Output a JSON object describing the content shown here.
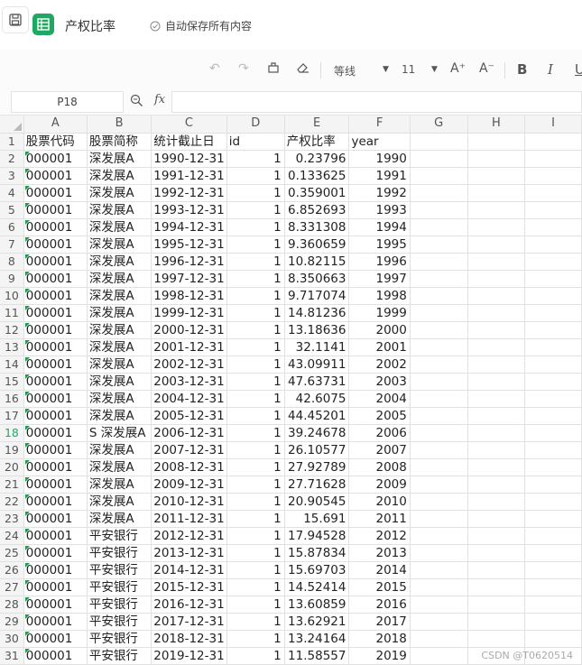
{
  "app": {
    "doc_title": "产权比率",
    "autosave": "自动保存所有内容"
  },
  "toolbar": {
    "font_name": "等线",
    "font_size": "11",
    "bold": "B",
    "italic": "I",
    "underline": "U",
    "grow": "A⁺",
    "shrink": "A⁻"
  },
  "formula_bar": {
    "name_box": "P18",
    "fx": "fx",
    "value": ""
  },
  "columns": [
    "A",
    "B",
    "C",
    "D",
    "E",
    "F",
    "G",
    "H",
    "I"
  ],
  "selected_row": 18,
  "rows": [
    [
      "股票代码",
      "股票简称",
      "统计截止日",
      "id",
      "产权比率",
      "year"
    ],
    [
      "000001",
      "深发展A",
      "1990-12-31",
      "1",
      "0.23796",
      "1990"
    ],
    [
      "000001",
      "深发展A",
      "1991-12-31",
      "1",
      "0.133625",
      "1991"
    ],
    [
      "000001",
      "深发展A",
      "1992-12-31",
      "1",
      "0.359001",
      "1992"
    ],
    [
      "000001",
      "深发展A",
      "1993-12-31",
      "1",
      "6.852693",
      "1993"
    ],
    [
      "000001",
      "深发展A",
      "1994-12-31",
      "1",
      "8.331308",
      "1994"
    ],
    [
      "000001",
      "深发展A",
      "1995-12-31",
      "1",
      "9.360659",
      "1995"
    ],
    [
      "000001",
      "深发展A",
      "1996-12-31",
      "1",
      "10.82115",
      "1996"
    ],
    [
      "000001",
      "深发展A",
      "1997-12-31",
      "1",
      "8.350663",
      "1997"
    ],
    [
      "000001",
      "深发展A",
      "1998-12-31",
      "1",
      "9.717074",
      "1998"
    ],
    [
      "000001",
      "深发展A",
      "1999-12-31",
      "1",
      "14.81236",
      "1999"
    ],
    [
      "000001",
      "深发展A",
      "2000-12-31",
      "1",
      "13.18636",
      "2000"
    ],
    [
      "000001",
      "深发展A",
      "2001-12-31",
      "1",
      "32.1141",
      "2001"
    ],
    [
      "000001",
      "深发展A",
      "2002-12-31",
      "1",
      "43.09911",
      "2002"
    ],
    [
      "000001",
      "深发展A",
      "2003-12-31",
      "1",
      "47.63731",
      "2003"
    ],
    [
      "000001",
      "深发展A",
      "2004-12-31",
      "1",
      "42.6075",
      "2004"
    ],
    [
      "000001",
      "深发展A",
      "2005-12-31",
      "1",
      "44.45201",
      "2005"
    ],
    [
      "000001",
      "S 深发展A",
      "2006-12-31",
      "1",
      "39.24678",
      "2006"
    ],
    [
      "000001",
      "深发展A",
      "2007-12-31",
      "1",
      "26.10577",
      "2007"
    ],
    [
      "000001",
      "深发展A",
      "2008-12-31",
      "1",
      "27.92789",
      "2008"
    ],
    [
      "000001",
      "深发展A",
      "2009-12-31",
      "1",
      "27.71628",
      "2009"
    ],
    [
      "000001",
      "深发展A",
      "2010-12-31",
      "1",
      "20.90545",
      "2010"
    ],
    [
      "000001",
      "深发展A",
      "2011-12-31",
      "1",
      "15.691",
      "2011"
    ],
    [
      "000001",
      "平安银行",
      "2012-12-31",
      "1",
      "17.94528",
      "2012"
    ],
    [
      "000001",
      "平安银行",
      "2013-12-31",
      "1",
      "15.87834",
      "2013"
    ],
    [
      "000001",
      "平安银行",
      "2014-12-31",
      "1",
      "15.69703",
      "2014"
    ],
    [
      "000001",
      "平安银行",
      "2015-12-31",
      "1",
      "14.52414",
      "2015"
    ],
    [
      "000001",
      "平安银行",
      "2016-12-31",
      "1",
      "13.60859",
      "2016"
    ],
    [
      "000001",
      "平安银行",
      "2017-12-31",
      "1",
      "13.62921",
      "2017"
    ],
    [
      "000001",
      "平安银行",
      "2018-12-31",
      "1",
      "13.24164",
      "2018"
    ],
    [
      "000001",
      "平安银行",
      "2019-12-31",
      "1",
      "11.58557",
      "2019"
    ]
  ],
  "watermark": "CSDN @T0620514"
}
